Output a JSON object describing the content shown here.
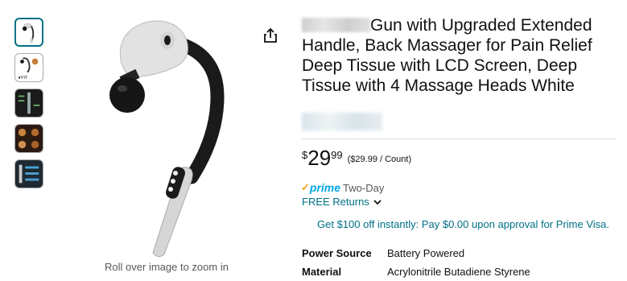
{
  "gallery": {
    "thumbnails": [
      {
        "name": "thumb-1",
        "selected": true
      },
      {
        "name": "thumb-2",
        "selected": false
      },
      {
        "name": "thumb-3",
        "selected": false
      },
      {
        "name": "thumb-4",
        "selected": false
      },
      {
        "name": "thumb-5",
        "selected": false
      }
    ],
    "zoom_hint": "Roll over image to zoom in"
  },
  "product": {
    "title": "Gun with Upgraded Extended Handle, Back Massager for Pain Relief Deep Tissue with LCD Screen, Deep Tissue with 4 Massage Heads White",
    "price_symbol": "$",
    "price_whole": "29",
    "price_fraction": "99",
    "unit_price": "($29.99 / Count)"
  },
  "delivery": {
    "prime_check": "✓",
    "prime_label": "prime",
    "prime_extra": "Two-Day",
    "returns_label": "FREE Returns"
  },
  "offer": {
    "text": "Get $100 off instantly: Pay $0.00 upon approval for Prime Visa."
  },
  "specs": [
    {
      "key": "Power Source",
      "value": "Battery Powered"
    },
    {
      "key": "Material",
      "value": "Acrylonitrile Butadiene Styrene"
    }
  ],
  "icons": {
    "share": "share-icon",
    "returns_chevron": "chevron-down-icon"
  },
  "colors": {
    "link": "#007185",
    "prime_blue": "#00a8e1",
    "prime_check": "#f59f1f",
    "selected_border": "#007185"
  }
}
